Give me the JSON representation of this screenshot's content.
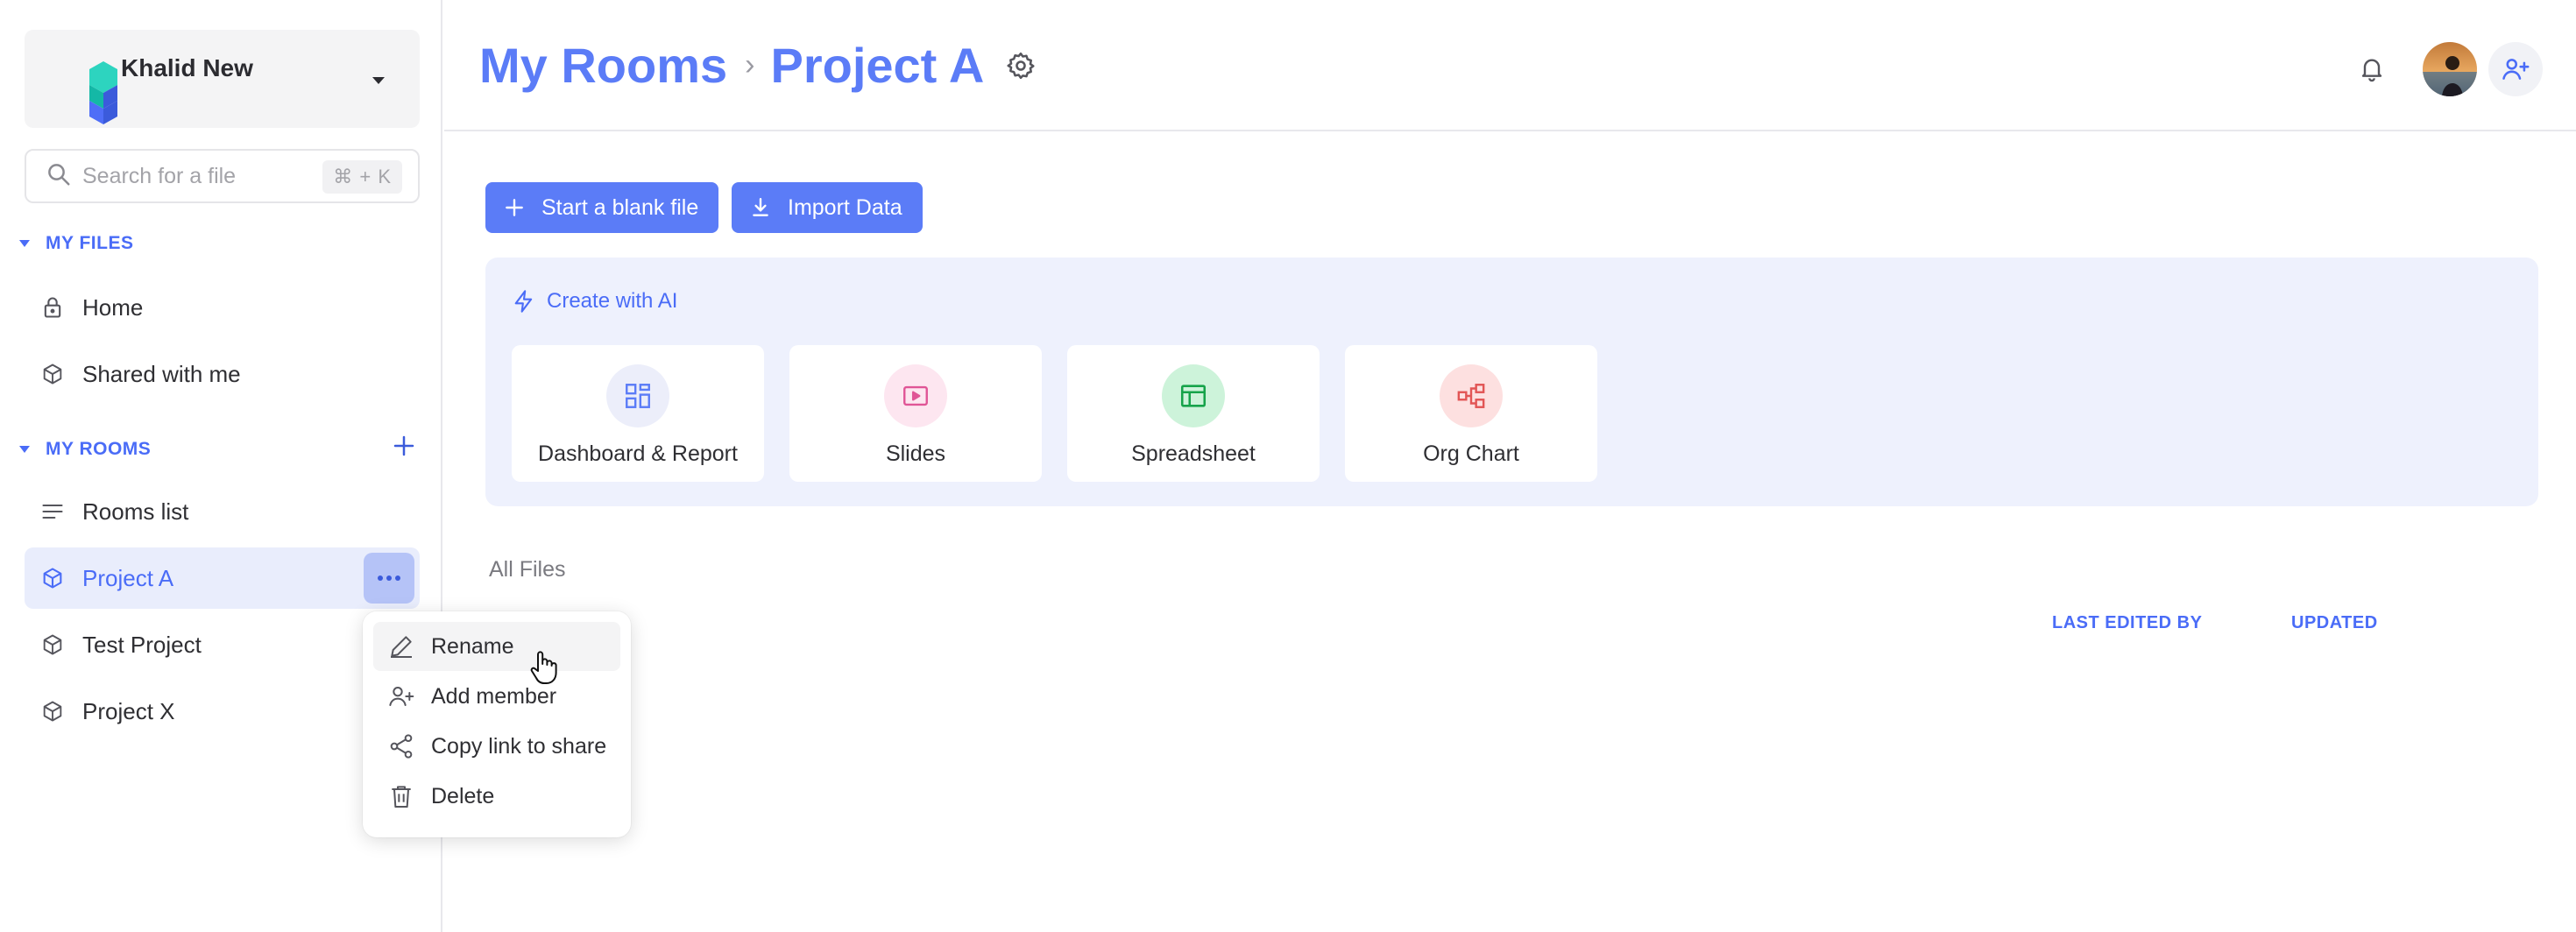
{
  "workspace": {
    "name": "Khalid New"
  },
  "search": {
    "placeholder": "Search for a file",
    "shortcut": "⌘ + K"
  },
  "sidebar": {
    "my_files_header": "MY FILES",
    "my_files": [
      {
        "label": "Home",
        "icon": "lock-icon"
      },
      {
        "label": "Shared with me",
        "icon": "cube-icon"
      }
    ],
    "my_rooms_header": "MY ROOMS",
    "rooms": [
      {
        "label": "Rooms list",
        "icon": "list-icon"
      },
      {
        "label": "Project A",
        "icon": "cube-icon",
        "active": true
      },
      {
        "label": "Test Project",
        "icon": "cube-icon"
      },
      {
        "label": "Project X",
        "icon": "cube-icon"
      }
    ]
  },
  "context_menu": {
    "items": [
      {
        "label": "Rename",
        "icon": "pencil-icon"
      },
      {
        "label": "Add member",
        "icon": "add-user-icon"
      },
      {
        "label": "Copy link to share",
        "icon": "share-icon"
      },
      {
        "label": "Delete",
        "icon": "trash-icon"
      }
    ]
  },
  "header": {
    "breadcrumb": [
      "My Rooms",
      "Project A"
    ],
    "separator": "›"
  },
  "actions": {
    "blank_file": "Start a blank file",
    "import_data": "Import Data"
  },
  "ai_panel": {
    "title": "Create with AI",
    "cards": [
      {
        "label": "Dashboard & Report",
        "icon": "dashboard-icon",
        "color": "#5b7cf7",
        "bg": "#eceefa"
      },
      {
        "label": "Slides",
        "icon": "play-icon",
        "color": "#e05596",
        "bg": "#fde6f0"
      },
      {
        "label": "Spreadsheet",
        "icon": "table-icon",
        "color": "#16a34a",
        "bg": "#cdf3da"
      },
      {
        "label": "Org Chart",
        "icon": "org-chart-icon",
        "color": "#e25555",
        "bg": "#fde0e0"
      }
    ]
  },
  "files": {
    "section_label": "All Files",
    "columns": [
      "LAST EDITED BY",
      "UPDATED"
    ]
  },
  "colors": {
    "accent": "#5b7cf7",
    "accent_dark": "#4a6cf7",
    "active_bg": "#e9edfc"
  }
}
